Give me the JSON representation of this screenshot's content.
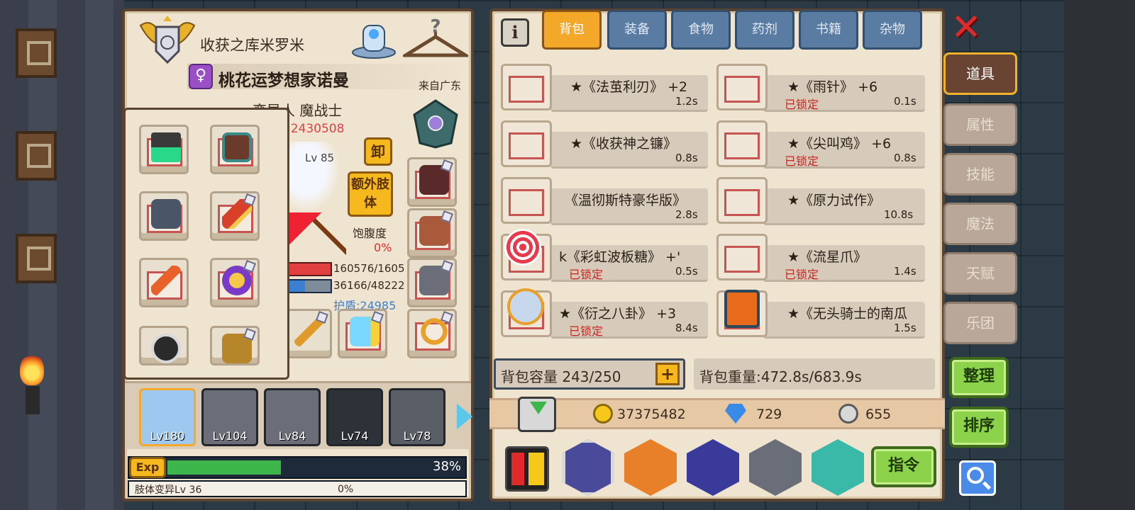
{
  "profile": {
    "guild_name": "收获之库米罗米",
    "player_name": "桃花运梦想家诺曼",
    "gender_symbol": "♀",
    "location": "来自广东",
    "race_class": "变异人 魔战士",
    "power": ":2430508",
    "level": "Lv 85",
    "unequip_label": "卸",
    "extra_limb_label": "额外肢体",
    "satiety_label": "饱腹度",
    "satiety_value": "0%",
    "hp": "160576/1605",
    "mp": "36166/48222",
    "shield": "护盾:24985"
  },
  "party": [
    {
      "level": "Lv180",
      "selected": true
    },
    {
      "level": "Lv104",
      "selected": false
    },
    {
      "level": "Lv84",
      "selected": false
    },
    {
      "level": "Lv74",
      "selected": false
    },
    {
      "level": "Lv78",
      "selected": false
    }
  ],
  "exp": {
    "label": "Exp",
    "percent_text": "38%",
    "fill": 0.38,
    "limb_label": "肢体变异Lv 36",
    "limb_percent": "0%"
  },
  "tabs": [
    "背包",
    "装备",
    "食物",
    "药剂",
    "书籍",
    "杂物"
  ],
  "active_tab": 0,
  "info_icon": "i",
  "inventory": [
    {
      "name": "★《法茧利刃》 +2",
      "time": "1.2s",
      "locked": false
    },
    {
      "name": "★《雨针》 +6",
      "time": "0.1s",
      "locked": true
    },
    {
      "name": "★《收获神之镰》",
      "time": "0.8s",
      "locked": false
    },
    {
      "name": "★《尖叫鸡》 +6",
      "time": "0.8s",
      "locked": true
    },
    {
      "name": "《温彻斯特豪华版》",
      "time": "2.8s",
      "locked": false
    },
    {
      "name": "★《原力试作》",
      "time": "10.8s",
      "locked": false
    },
    {
      "name": "k《彩虹波板糖》 +'",
      "time": "0.5s",
      "locked": true
    },
    {
      "name": "★《流星爪》",
      "time": "1.4s",
      "locked": true
    },
    {
      "name": "★《衍之八卦》 +3",
      "time": "8.4s",
      "locked": true
    },
    {
      "name": "★《无头骑士的南瓜",
      "time": "1.5s",
      "locked": false
    }
  ],
  "locked_label": "已锁定",
  "bag": {
    "capacity_label": "背包容量 243/250",
    "weight_label": "背包重量:472.8s/683.9s"
  },
  "currency": {
    "gold": "37375482",
    "diamond": "729",
    "silver": "655"
  },
  "side_tabs": [
    "道具",
    "属性",
    "技能",
    "魔法",
    "天赋",
    "乐团"
  ],
  "active_side_tab": 0,
  "buttons": {
    "sort": "整理",
    "order": "排序",
    "command": "指令",
    "close": "✕"
  },
  "colors": {
    "active_tab": "#f4a82a",
    "locked_text": "#c9241d",
    "exp_bar": "#3cb54a",
    "hp_bar": "#e04040",
    "mp_bar": "#3b7fd0"
  }
}
